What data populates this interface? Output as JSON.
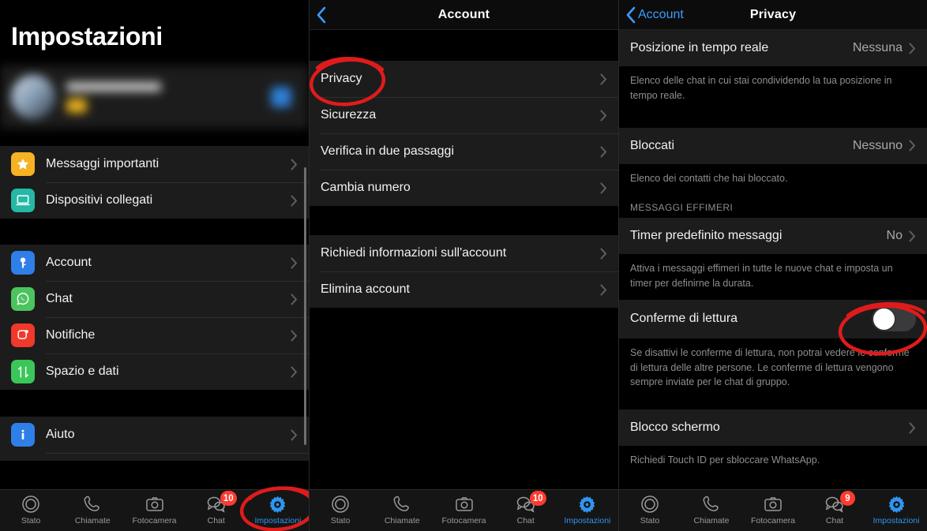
{
  "panels": {
    "settings": {
      "title": "Impostazioni",
      "profile": {
        "blurred": true,
        "qr_icon": "qr-code-icon"
      },
      "groups": [
        {
          "items": [
            {
              "label": "Messaggi importanti",
              "icon": "star-icon",
              "icon_color": "#f5b223"
            },
            {
              "label": "Dispositivi collegati",
              "icon": "laptop-icon",
              "icon_color": "#25b8a5"
            }
          ]
        },
        {
          "items": [
            {
              "label": "Account",
              "icon": "key-icon",
              "icon_color": "#2f7fe8"
            },
            {
              "label": "Chat",
              "icon": "whatsapp-icon",
              "icon_color": "#4cc45d"
            },
            {
              "label": "Notifiche",
              "icon": "bell-icon",
              "icon_color": "#f0382b"
            },
            {
              "label": "Spazio e dati",
              "icon": "arrows-updown-icon",
              "icon_color": "#3bc65a"
            }
          ]
        },
        {
          "items": [
            {
              "label": "Aiuto",
              "icon": "info-icon",
              "icon_color": "#2f7fe8"
            }
          ]
        }
      ],
      "tabbar": {
        "tabs": [
          {
            "label": "Stato",
            "icon": "status-rings-icon",
            "badge": "",
            "active": false
          },
          {
            "label": "Chiamate",
            "icon": "phone-icon",
            "badge": "",
            "active": false
          },
          {
            "label": "Fotocamera",
            "icon": "camera-icon",
            "badge": "",
            "active": false
          },
          {
            "label": "Chat",
            "icon": "chat-bubbles-icon",
            "badge": "10",
            "active": false
          },
          {
            "label": "Impostazioni",
            "icon": "gear-icon",
            "badge": "",
            "active": true
          }
        ]
      }
    },
    "account": {
      "nav": {
        "back_label": "",
        "title": "Account"
      },
      "groups": [
        {
          "items": [
            {
              "label": "Privacy"
            },
            {
              "label": "Sicurezza"
            },
            {
              "label": "Verifica in due passaggi"
            },
            {
              "label": "Cambia numero"
            }
          ]
        },
        {
          "items": [
            {
              "label": "Richiedi informazioni sull'account"
            },
            {
              "label": "Elimina account"
            }
          ]
        }
      ],
      "tabbar": {
        "tabs": [
          {
            "label": "Stato",
            "icon": "status-rings-icon",
            "badge": "",
            "active": false
          },
          {
            "label": "Chiamate",
            "icon": "phone-icon",
            "badge": "",
            "active": false
          },
          {
            "label": "Fotocamera",
            "icon": "camera-icon",
            "badge": "",
            "active": false
          },
          {
            "label": "Chat",
            "icon": "chat-bubbles-icon",
            "badge": "10",
            "active": false
          },
          {
            "label": "Impostazioni",
            "icon": "gear-icon",
            "badge": "",
            "active": true
          }
        ]
      }
    },
    "privacy": {
      "nav": {
        "back_label": "Account",
        "title": "Privacy"
      },
      "rows": [
        {
          "type": "link",
          "label": "Posizione in tempo reale",
          "value": "Nessuna"
        },
        {
          "type": "desc",
          "text": "Elenco delle chat in cui stai condividendo la tua posizione in tempo reale."
        },
        {
          "type": "link",
          "label": "Bloccati",
          "value": "Nessuno"
        },
        {
          "type": "desc",
          "text": "Elenco dei contatti che hai bloccato."
        },
        {
          "type": "section",
          "text": "MESSAGGI EFFIMERI"
        },
        {
          "type": "link",
          "label": "Timer predefinito messaggi",
          "value": "No"
        },
        {
          "type": "desc",
          "text": "Attiva i messaggi effimeri in tutte le nuove chat e imposta un timer per definirne la durata."
        },
        {
          "type": "toggle",
          "label": "Conferme di lettura",
          "state": "off"
        },
        {
          "type": "desc",
          "text": "Se disattivi le conferme di lettura, non potrai vedere le conferme di lettura delle altre persone. Le conferme di lettura vengono sempre inviate per le chat di gruppo."
        },
        {
          "type": "link",
          "label": "Blocco schermo",
          "value": ""
        },
        {
          "type": "desc",
          "text": "Richiedi Touch ID per sbloccare WhatsApp."
        }
      ],
      "tabbar": {
        "tabs": [
          {
            "label": "Stato",
            "icon": "status-rings-icon",
            "badge": "",
            "active": false
          },
          {
            "label": "Chiamate",
            "icon": "phone-icon",
            "badge": "",
            "active": false
          },
          {
            "label": "Fotocamera",
            "icon": "camera-icon",
            "badge": "",
            "active": false
          },
          {
            "label": "Chat",
            "icon": "chat-bubbles-icon",
            "badge": "9",
            "active": false
          },
          {
            "label": "Impostazioni",
            "icon": "gear-icon",
            "badge": "",
            "active": true
          }
        ]
      }
    }
  },
  "annotations": {
    "color": "#e01b1b",
    "marks": [
      {
        "name": "privacy-circle",
        "target": "Privacy"
      },
      {
        "name": "toggle-circle",
        "target": "Conferme di lettura"
      },
      {
        "name": "settings-tab-circle",
        "target": "Impostazioni"
      }
    ]
  },
  "colors": {
    "accent_blue": "#2f95ef",
    "row_bg": "#1c1c1c",
    "page_bg": "#000000",
    "badge_red": "#ff3b30",
    "annotation_red": "#e01b1b",
    "secondary_text": "#8e8e8e"
  }
}
